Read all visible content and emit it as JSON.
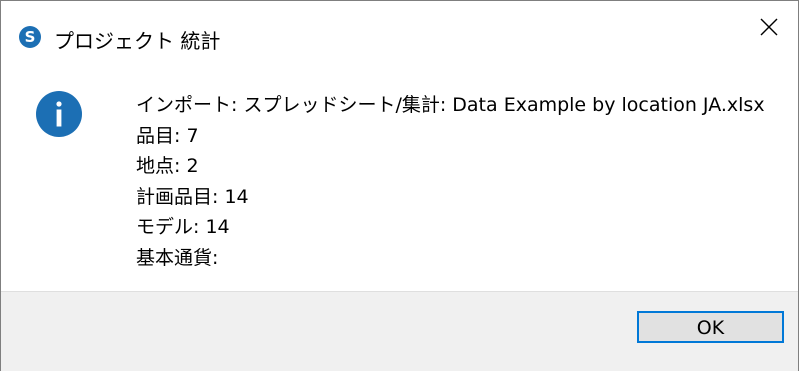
{
  "window": {
    "title": "プロジェクト 統計",
    "app_icon": "S",
    "close_glyph": "✕"
  },
  "message": {
    "lines": [
      "インポート: スプレッドシート/集計: Data Example by location JA.xlsx",
      "品目: 7",
      "地点: 2",
      "計画品目: 14",
      "モデル: 14",
      "基本通貨:"
    ]
  },
  "buttons": {
    "ok_label": "OK"
  },
  "colors": {
    "accent": "#0078d7",
    "info_icon": "#1c6fb4",
    "footer_bg": "#f0f0f0"
  },
  "icons": {
    "app": "app-logo-icon",
    "info": "info-icon",
    "close": "close-icon"
  }
}
